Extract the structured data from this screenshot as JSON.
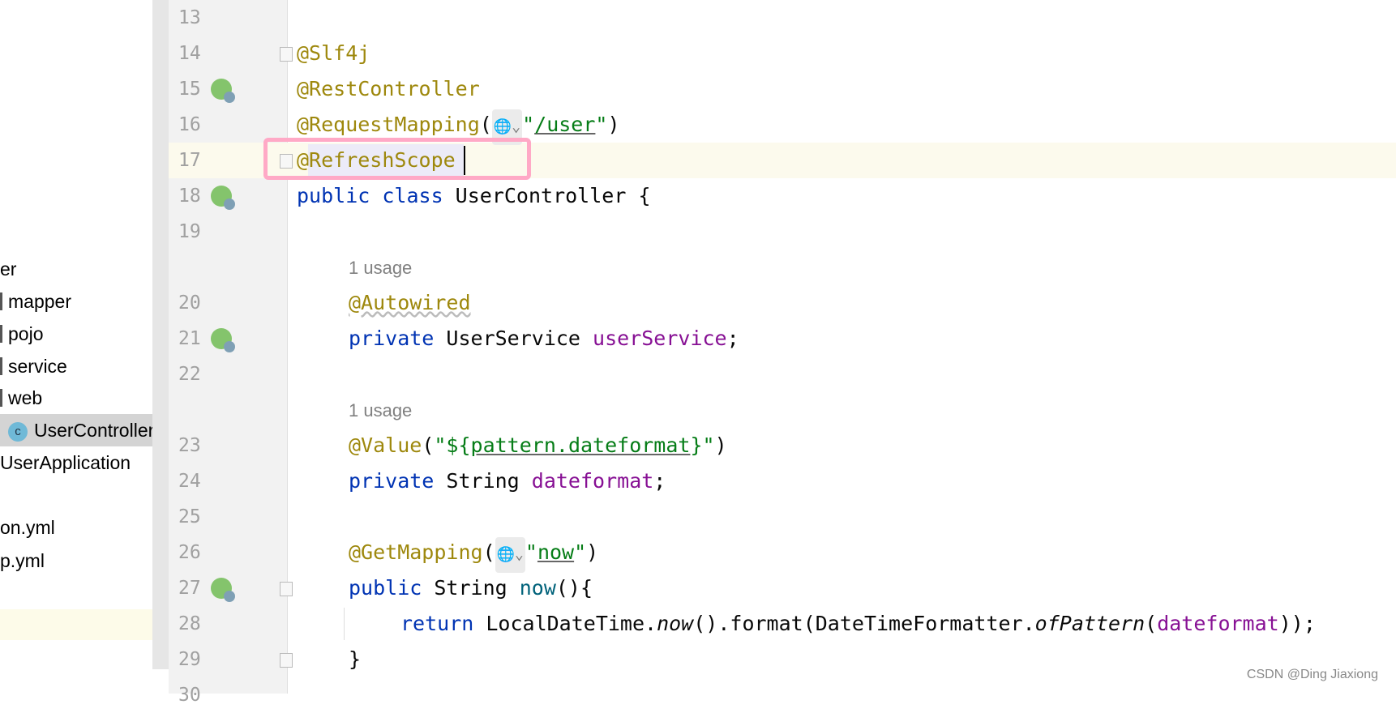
{
  "project_tree": {
    "items": [
      {
        "label": "er",
        "bar": false,
        "selected": false
      },
      {
        "label": "mapper",
        "bar": true,
        "selected": false
      },
      {
        "label": "pojo",
        "bar": true,
        "selected": false
      },
      {
        "label": "service",
        "bar": true,
        "selected": false
      },
      {
        "label": "web",
        "bar": true,
        "selected": false
      },
      {
        "label": "UserController",
        "bar": false,
        "selected": true,
        "icon": "class-icon",
        "icon_letter": "c"
      },
      {
        "label": "UserApplication",
        "bar": false,
        "selected": false,
        "icon": "spring-app-icon"
      },
      {
        "label": "",
        "bar": false,
        "selected": false
      },
      {
        "label": "on.yml",
        "bar": false,
        "selected": false
      },
      {
        "label": "p.yml",
        "bar": false,
        "selected": false
      }
    ]
  },
  "editor": {
    "current_line": 17,
    "rows": [
      {
        "line": "13",
        "tokens": []
      },
      {
        "line": "14",
        "fold": true,
        "tokens": [
          [
            "@Slf4j",
            "annotation"
          ]
        ]
      },
      {
        "line": "15",
        "icon": "spring-bean-check-icon",
        "tokens": [
          [
            "@RestController",
            "annotation"
          ]
        ]
      },
      {
        "line": "16",
        "tokens": [
          [
            "@RequestMapping",
            "annotation"
          ],
          [
            "(",
            "plain"
          ],
          [
            "globe",
            "globe"
          ],
          [
            "\"",
            "string"
          ],
          [
            "/user",
            "link"
          ],
          [
            "\"",
            "string"
          ],
          [
            ")",
            "plain"
          ]
        ]
      },
      {
        "line": "17",
        "fold": true,
        "tokens": [
          [
            "@RefreshScope",
            "annotation"
          ]
        ]
      },
      {
        "line": "18",
        "icon": "spring-bean-class-icon",
        "tokens": [
          [
            "public class ",
            "keyword"
          ],
          [
            "UserController {",
            "plain"
          ]
        ]
      },
      {
        "line": "19",
        "tokens": []
      },
      {
        "line": "",
        "usage": "1 usage",
        "indent": 1
      },
      {
        "line": "20",
        "indent": 1,
        "tokens": [
          [
            "@Autowired",
            "annotation wavy"
          ]
        ]
      },
      {
        "line": "21",
        "icon": "spring-autowired-icon",
        "indent": 1,
        "tokens": [
          [
            "private ",
            "keyword"
          ],
          [
            "UserService ",
            "plain"
          ],
          [
            "userService",
            "field"
          ],
          [
            ";",
            "plain"
          ]
        ]
      },
      {
        "line": "22",
        "tokens": []
      },
      {
        "line": "",
        "usage": "1 usage",
        "indent": 1
      },
      {
        "line": "23",
        "indent": 1,
        "tokens": [
          [
            "@Value",
            "annotation"
          ],
          [
            "(",
            "plain"
          ],
          [
            "\"${",
            "string"
          ],
          [
            "pattern.dateformat",
            "link"
          ],
          [
            "}\"",
            "string"
          ],
          [
            ")",
            "plain"
          ]
        ]
      },
      {
        "line": "24",
        "indent": 1,
        "tokens": [
          [
            "private ",
            "keyword"
          ],
          [
            "String ",
            "plain"
          ],
          [
            "dateformat",
            "field"
          ],
          [
            ";",
            "plain"
          ]
        ]
      },
      {
        "line": "25",
        "tokens": []
      },
      {
        "line": "26",
        "indent": 1,
        "tokens": [
          [
            "@GetMapping",
            "annotation"
          ],
          [
            "(",
            "plain"
          ],
          [
            "globe",
            "globe"
          ],
          [
            "\"",
            "string"
          ],
          [
            "now",
            "link"
          ],
          [
            "\"",
            "string"
          ],
          [
            ")",
            "plain"
          ]
        ]
      },
      {
        "line": "27",
        "icon": "spring-web-endpoint-icon",
        "fold": true,
        "indent": 1,
        "tokens": [
          [
            "public ",
            "keyword"
          ],
          [
            "String ",
            "plain"
          ],
          [
            "now",
            "method"
          ],
          [
            "(){",
            "plain"
          ]
        ]
      },
      {
        "line": "28",
        "indent": 2,
        "tokens": [
          [
            "return ",
            "keyword"
          ],
          [
            "LocalDateTime.",
            "plain"
          ],
          [
            "now",
            "plain italic"
          ],
          [
            "().format(DateTimeFormatter.",
            "plain"
          ],
          [
            "ofPattern",
            "plain italic"
          ],
          [
            "(",
            "plain"
          ],
          [
            "dateformat",
            "field"
          ],
          [
            "));",
            "plain"
          ]
        ]
      },
      {
        "line": "29",
        "fold": true,
        "indent": 1,
        "tokens": [
          [
            "}",
            "plain"
          ]
        ]
      },
      {
        "line": "30",
        "tokens": []
      }
    ]
  },
  "highlight_color": "#ffa9c6",
  "watermark": "CSDN @Ding Jiaxiong"
}
